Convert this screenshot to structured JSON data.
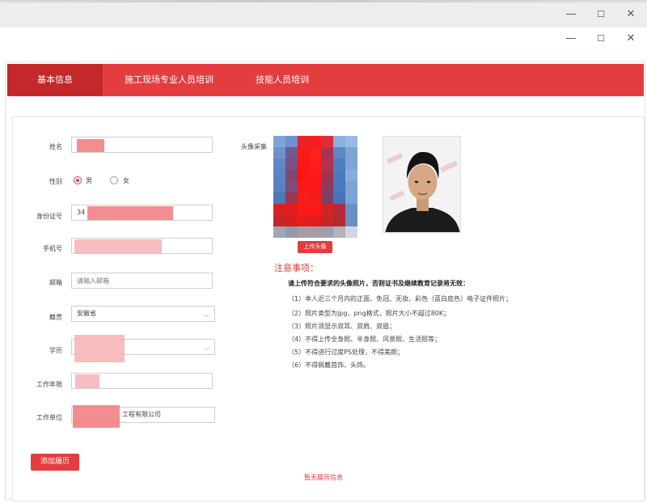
{
  "window": {
    "minimize_glyph": "—",
    "maximize_glyph": "☐",
    "close_glyph": "✕"
  },
  "tabs": [
    {
      "label": "基本信息",
      "active": true
    },
    {
      "label": "施工现场专业人员培训",
      "active": false
    },
    {
      "label": "技能人员培训",
      "active": false
    }
  ],
  "form": {
    "name": {
      "label": "姓名",
      "value": ""
    },
    "gender": {
      "label": "性别",
      "options": [
        "男",
        "女"
      ],
      "selected": "男"
    },
    "id_number": {
      "label": "身份证号",
      "value_prefix": "34"
    },
    "phone": {
      "label": "手机号",
      "value": ""
    },
    "email": {
      "label": "邮箱",
      "placeholder": "请输入邮箱"
    },
    "native_place": {
      "label": "籍贯",
      "value": "安徽省"
    },
    "education": {
      "label": "学历",
      "value": ""
    },
    "work_years": {
      "label": "工作年限",
      "value": ""
    },
    "employer": {
      "label": "工作单位",
      "value_suffix": "工程有限公司"
    }
  },
  "photo": {
    "label": "头像采集",
    "upload_button": "上传头像"
  },
  "notes": {
    "title": "注意事项：",
    "bold_line": "请上传符合要求的头像照片，否则证书及继续教育记录将无效：",
    "items": [
      "（1）本人近三个月内的正面、免冠、无妆、彩色（蓝白底色）电子证件照片；",
      "（2）照片类型为jpg、png格式，照片大小不超过80K；",
      "（3）照片须显示双耳、双肩、双眉；",
      "（4）不得上传全身照、半身照、风景照、生活照等；",
      "（5）不得进行过度PS处理，不得美颜；",
      "（6）不得佩戴首饰、头饰。"
    ]
  },
  "history": {
    "add_button": "添加履历",
    "empty_text": "暂无履历信息"
  },
  "colors": {
    "accent": "#e43d40",
    "accent_dark": "#c4282a"
  }
}
